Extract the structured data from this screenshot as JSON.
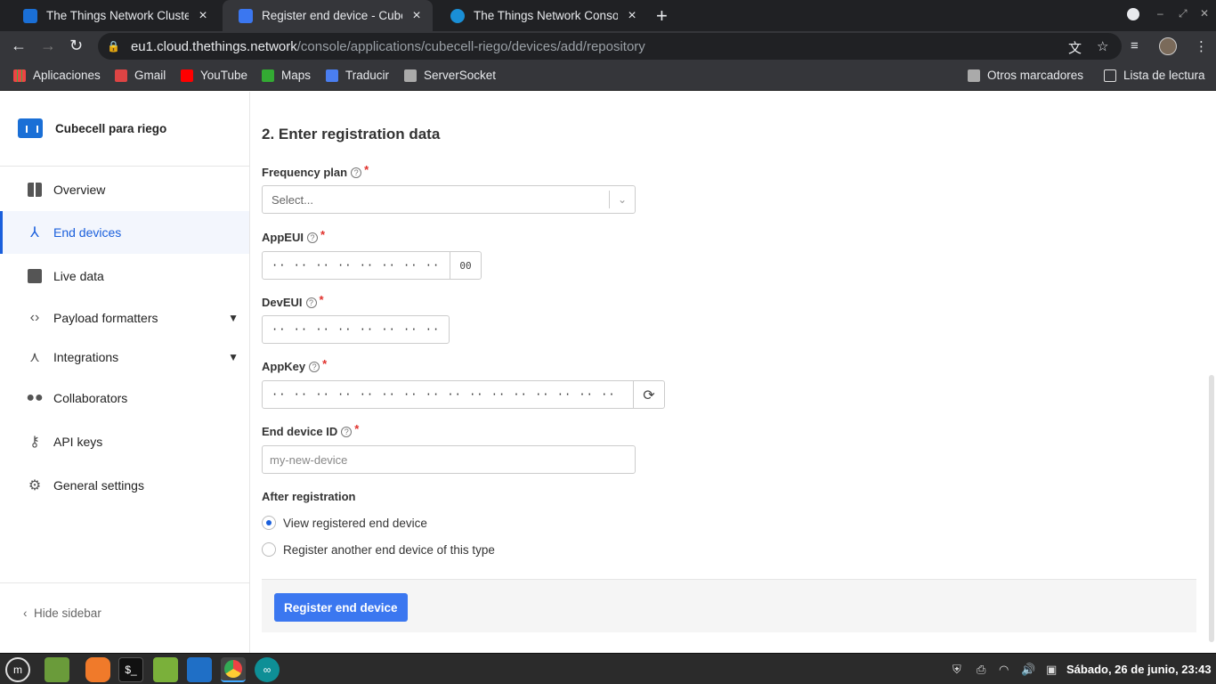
{
  "browser": {
    "tabs": [
      {
        "title": "The Things Network Cluster P",
        "fav_color": "#1a6fd6",
        "active": false
      },
      {
        "title": "Register end device - Cubecell",
        "fav_color": "#3b77f0",
        "active": true
      },
      {
        "title": "The Things Network Console",
        "fav_color": "#1a8fd6",
        "active": false
      }
    ],
    "url_host": "eu1.cloud.thethings.network",
    "url_path": "/console/applications/cubecell-riego/devices/add/repository",
    "bookmarks": [
      "Aplicaciones",
      "Gmail",
      "YouTube",
      "Maps",
      "Traducir",
      "ServerSocket"
    ],
    "bookmarks_right": [
      "Otros marcadores",
      "Lista de lectura"
    ]
  },
  "sidebar": {
    "app_name": "Cubecell para riego",
    "items": [
      {
        "label": "Overview",
        "icon": "dashboard-icon"
      },
      {
        "label": "End devices",
        "icon": "devices-icon"
      },
      {
        "label": "Live data",
        "icon": "chart-icon"
      },
      {
        "label": "Payload formatters",
        "icon": "code-icon"
      },
      {
        "label": "Integrations",
        "icon": "merge-icon"
      },
      {
        "label": "Collaborators",
        "icon": "people-icon"
      },
      {
        "label": "API keys",
        "icon": "key-icon"
      },
      {
        "label": "General settings",
        "icon": "gear-icon"
      }
    ],
    "hide_label": "Hide sidebar"
  },
  "form": {
    "heading": "2. Enter registration data",
    "frequency_plan": {
      "label": "Frequency plan",
      "placeholder": "Select..."
    },
    "app_eui": {
      "label": "AppEUI",
      "value": "·· ·· ·· ·· ·· ·· ·· ··",
      "addon": "00"
    },
    "dev_eui": {
      "label": "DevEUI",
      "value": "·· ·· ·· ·· ·· ·· ·· ··"
    },
    "app_key": {
      "label": "AppKey",
      "value": "·· ·· ·· ·· ·· ·· ·· ·· ·· ·· ·· ·· ·· ·· ·· ··"
    },
    "device_id": {
      "label": "End device ID",
      "placeholder": "my-new-device"
    },
    "after_registration": {
      "label": "After registration",
      "option_view": "View registered end device",
      "option_another": "Register another end device of this type"
    },
    "submit_label": "Register end device"
  },
  "taskbar": {
    "clock": "Sábado, 26 de junio, 23:43"
  }
}
